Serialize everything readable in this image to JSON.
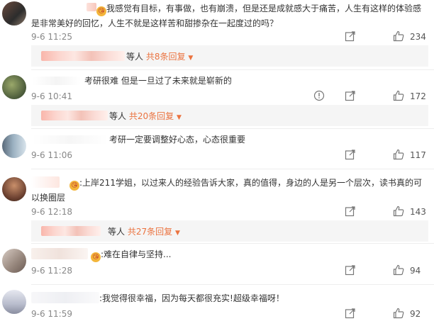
{
  "comments": [
    {
      "text_pre": "",
      "emoji": "😘",
      "text": "我感觉有目标，有事做，也有崩溃，但是还是成就感大于痛苦，人生有这样的体验感是非常美好的回忆，人生不就是这样苦和甜掺杂在一起度过的吗？",
      "time": "9-6 11:25",
      "likes": "234",
      "has_comment_icon": false,
      "replies": {
        "prefix": "等人",
        "label": "共8条回复"
      }
    },
    {
      "text_pre": "",
      "emoji": "",
      "text": "考研很难 但是一旦过了未来就是崭新的",
      "time": "9-6 10:41",
      "likes": "172",
      "has_comment_icon": true,
      "replies": {
        "prefix": "等人",
        "label": "共20条回复"
      }
    },
    {
      "text_pre": "",
      "emoji": "",
      "text": "考研一定要调整好心态，心态很重要",
      "time": "9-6 11:06",
      "likes": "117",
      "has_comment_icon": false,
      "replies": null
    },
    {
      "text_pre": "",
      "emoji": "😘",
      "text": ":上岸211学姐，以过来人的经验告诉大家，真的值得，身边的人是另一个层次，读书真的可以换圈层",
      "time": "9-6 12:18",
      "likes": "143",
      "has_comment_icon": false,
      "replies": {
        "prefix": "等人",
        "label": "共27条回复"
      }
    },
    {
      "text_pre": "",
      "emoji": "😘",
      "text": ":难在自律与坚持...",
      "time": "9-6 11:28",
      "likes": "94",
      "has_comment_icon": false,
      "replies": null
    },
    {
      "text_pre": "",
      "emoji": "",
      "text": ":我觉得很幸福，因为每天都很充实!超级幸福呀！",
      "time": "9-6 11:59",
      "likes": "92",
      "has_comment_icon": false,
      "replies": null
    }
  ],
  "icons": {
    "share": "share-icon",
    "comment": "comment-icon",
    "like": "thumbs-up-icon",
    "dropdown": "caret-down-icon"
  },
  "colors": {
    "accent": "#eb7340",
    "muted": "#888888",
    "reply_bg": "#f5f5f5"
  }
}
